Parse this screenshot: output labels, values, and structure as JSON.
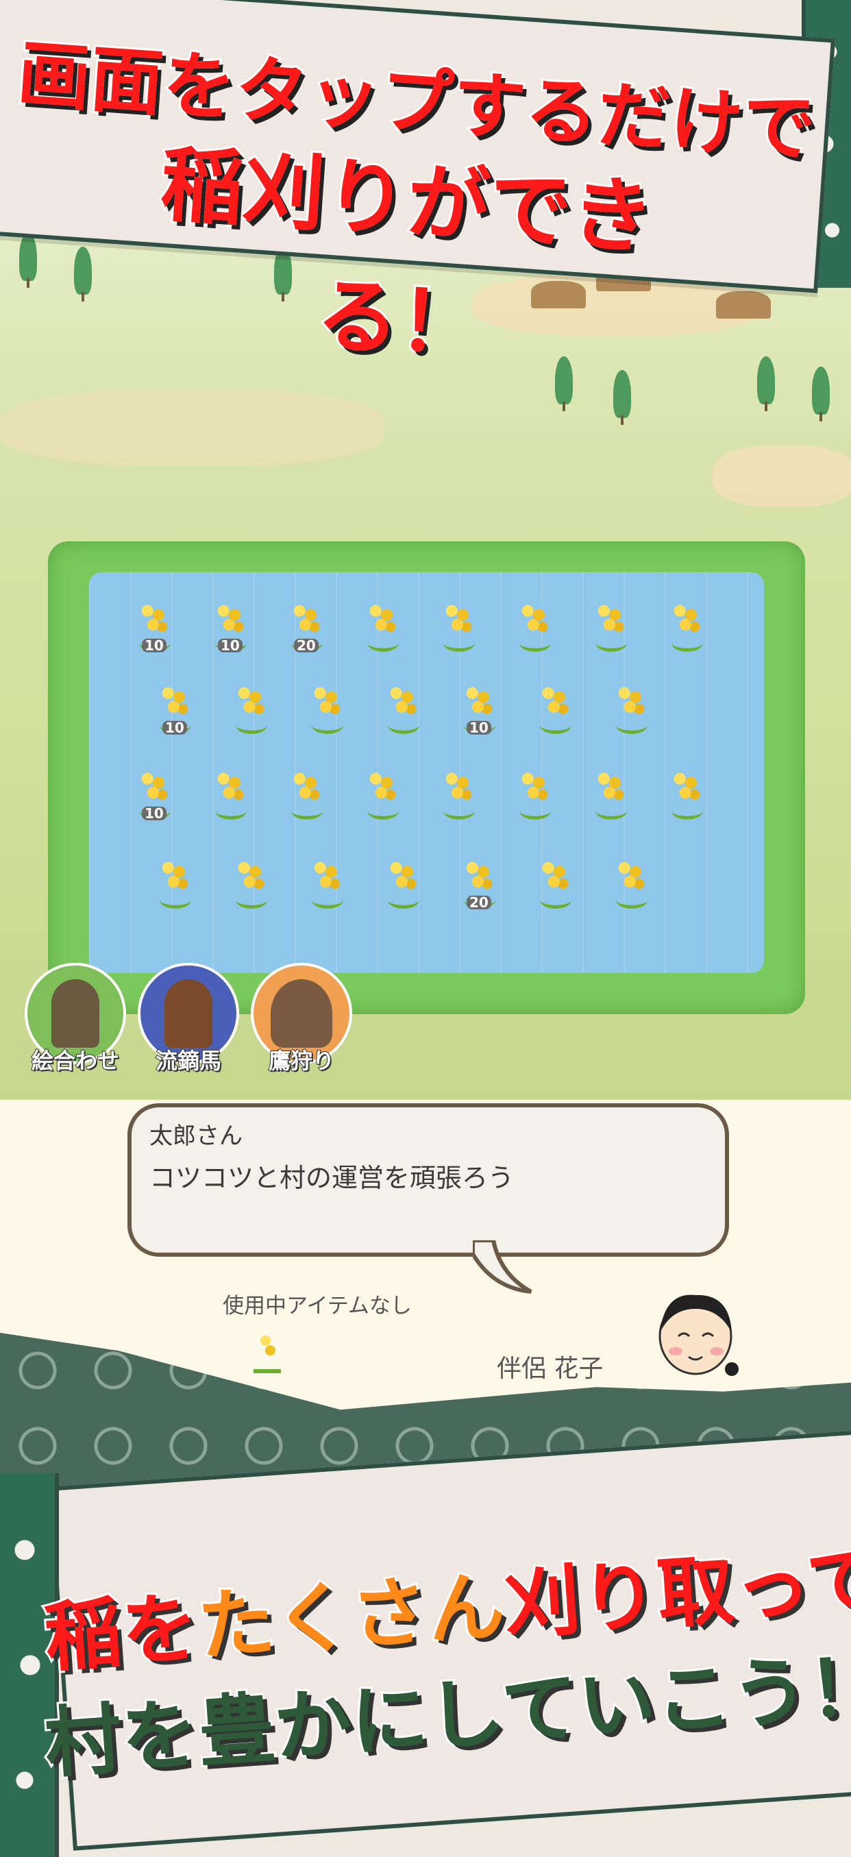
{
  "top_banner": {
    "line1": "画面をタップするだけで",
    "line2": "稲刈りができる！"
  },
  "field": {
    "rows": [
      [
        {
          "badge": "10"
        },
        {
          "badge": "10"
        },
        {
          "badge": "20"
        },
        {
          "badge": ""
        },
        {
          "badge": ""
        },
        {
          "badge": ""
        },
        {
          "badge": ""
        },
        {
          "badge": ""
        }
      ],
      [
        {
          "badge": "10"
        },
        {
          "badge": ""
        },
        {
          "badge": ""
        },
        {
          "badge": ""
        },
        {
          "badge": "10"
        },
        {
          "badge": ""
        },
        {
          "badge": ""
        }
      ],
      [
        {
          "badge": "10"
        },
        {
          "badge": ""
        },
        {
          "badge": ""
        },
        {
          "badge": ""
        },
        {
          "badge": ""
        },
        {
          "badge": ""
        },
        {
          "badge": ""
        },
        {
          "badge": ""
        }
      ],
      [
        {
          "badge": ""
        },
        {
          "badge": ""
        },
        {
          "badge": ""
        },
        {
          "badge": ""
        },
        {
          "badge": "20"
        },
        {
          "badge": ""
        },
        {
          "badge": ""
        }
      ]
    ]
  },
  "skills": [
    {
      "label": "絵合わせ",
      "icon": "elder-portrait-icon",
      "color": "#7fbf5a"
    },
    {
      "label": "流鏑馬",
      "icon": "archer-horse-icon",
      "color": "#4a5fb8"
    },
    {
      "label": "鷹狩り",
      "icon": "hawk-icon",
      "color": "#f0a050"
    }
  ],
  "dialog": {
    "speaker": "太郎さん",
    "message": "コツコツと村の運営を頑張ろう"
  },
  "status": {
    "item": "使用中アイテムなし",
    "partner": "伴侶 花子"
  },
  "bottom_banner": {
    "line1_a": "稲を",
    "line1_b": "たくさん",
    "line1_c": "刈り取って",
    "line2": "村を豊かにしていこう！"
  },
  "colors": {
    "headline_red": "#ff1a1a",
    "headline_orange": "#ff8a1a",
    "banner_green": "#2f6c54"
  }
}
